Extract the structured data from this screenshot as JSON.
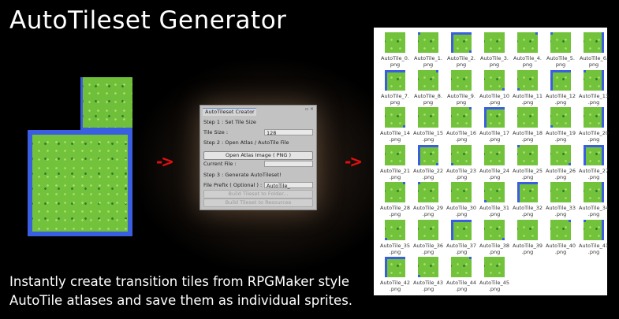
{
  "title": "AutoTileset Generator",
  "arrow": "->",
  "panel": {
    "tab": "AutoTileset Creator",
    "controls": "▫ ×",
    "step1": "Step 1 : Set Tile Size",
    "tile_size_label": "Tile Size :",
    "tile_size_value": "128",
    "step2": "Step 2 : Open Atlas / AutoTile File",
    "open_button": "Open Atlas Image ( PNG )",
    "current_file_label": "Current File :",
    "current_file_value": "",
    "step3": "Step 3 : Generate AutoTileset!",
    "prefix_label": "File Prefix ( Optional ) :",
    "prefix_value": "AutoTile_",
    "build_folder": "Build Tileset to Folder...",
    "build_resources": "Build Tileset to Resources"
  },
  "files": [
    "AutoTile_0.png",
    "AutoTile_1.png",
    "AutoTile_2.png",
    "AutoTile_3.png",
    "AutoTile_4.png",
    "AutoTile_5.png",
    "AutoTile_6.png",
    "AutoTile_7.png",
    "AutoTile_8.png",
    "AutoTile_9.png",
    "AutoTile_10.png",
    "AutoTile_11.png",
    "AutoTile_12.png",
    "AutoTile_13.png",
    "AutoTile_14.png",
    "AutoTile_15.png",
    "AutoTile_16.png",
    "AutoTile_17.png",
    "AutoTile_18.png",
    "AutoTile_19.png",
    "AutoTile_20.png",
    "AutoTile_21.png",
    "AutoTile_22.png",
    "AutoTile_23.png",
    "AutoTile_24.png",
    "AutoTile_25.png",
    "AutoTile_26.png",
    "AutoTile_27.png",
    "AutoTile_28.png",
    "AutoTile_29.png",
    "AutoTile_30.png",
    "AutoTile_31.png",
    "AutoTile_32.png",
    "AutoTile_33.png",
    "AutoTile_34.png",
    "AutoTile_35.png",
    "AutoTile_36.png",
    "AutoTile_37.png",
    "AutoTile_38.png",
    "AutoTile_39.png",
    "AutoTile_40.png",
    "AutoTile_41.png",
    "AutoTile_42.png",
    "AutoTile_43.png",
    "AutoTile_44.png",
    "AutoTile_45.png"
  ],
  "subtitle": [
    "Instantly create transition tiles from RPGMaker style",
    "AutoTile atlases and save them as individual sprites."
  ],
  "colors": {
    "grass": "#72c23b",
    "water": "#3a5ee0",
    "arrow": "#e01010"
  }
}
